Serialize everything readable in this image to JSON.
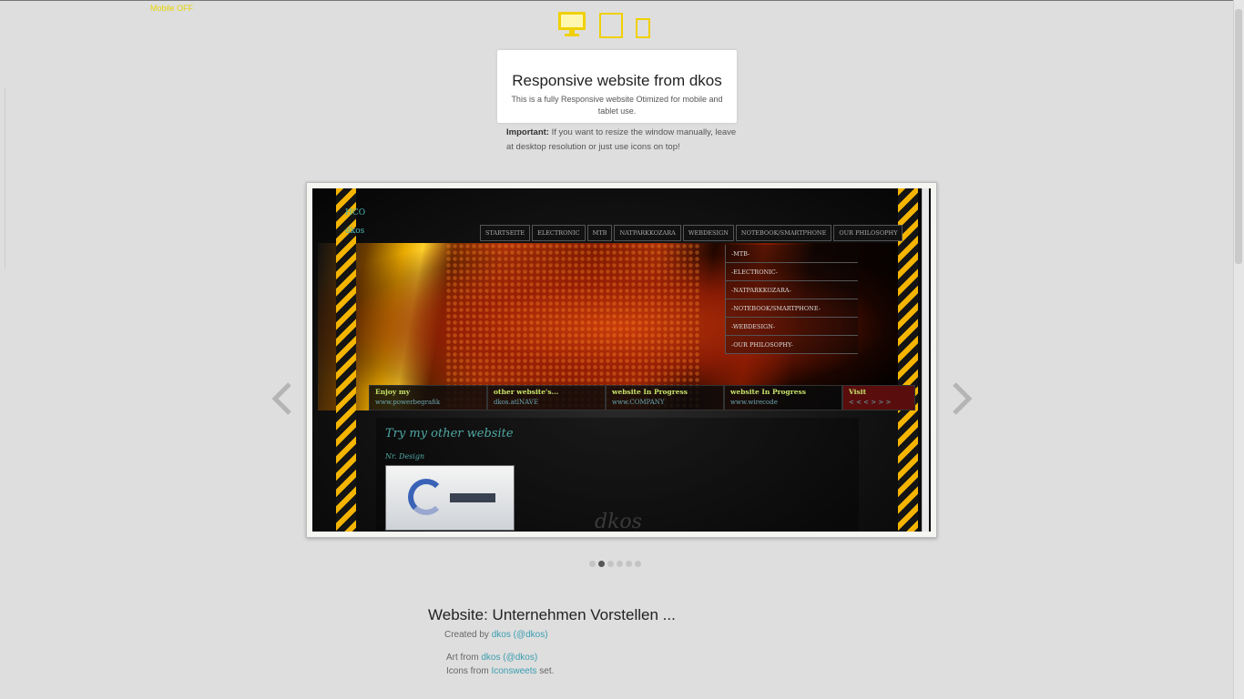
{
  "corner_label": "Mobile OFF",
  "devices": {
    "desktop": "desktop-icon",
    "tablet": "tablet-icon",
    "phone": "phone-icon",
    "accent_color": "#f0d000"
  },
  "intro": {
    "title": "Responsive website from dkos",
    "description": "This is a fully Responsive website Otimized for mobile and tablet use.",
    "important_label": "Important:",
    "important_text": " If you want to resize the window manually, leave at desktop resolution or just use icons on top!"
  },
  "slide": {
    "logo_top": "HCO",
    "logo_sub": "dkos",
    "nav": [
      "STARTSEITE",
      "ELECTRONIC",
      "MTB",
      "NATPARKKOZARA",
      "WEBDESIGN",
      "NOTEBOOK/SMARTPHONE",
      "OUR PHILOSOPHY"
    ],
    "submenu": [
      "-MTB-",
      "-ELECTRONIC-",
      "-NATPARKKOZARA-",
      "-NOTEBOOK/SMARTPHONE-",
      "-WEBDESIGN-",
      "-OUR PHILOSOPHY-"
    ],
    "links": [
      {
        "title": "Enjoy my",
        "url": "www.powerbegrafik"
      },
      {
        "title": "other website's...",
        "url": "dkos.atlNAVE"
      },
      {
        "title": "website In Progress",
        "url": "www.COMPANY"
      },
      {
        "title": "website In Progress",
        "url": "www.wirecode"
      },
      {
        "title": "Visit",
        "url": "< < < > > >"
      }
    ],
    "heading": "Try my other website",
    "subheading": "Nr. Design",
    "signature": "dkos"
  },
  "slider": {
    "prev_icon": "chevron-left-icon",
    "next_icon": "chevron-right-icon",
    "dot_count": 6,
    "active_dot": 1
  },
  "footer": {
    "title": "Website: Unternehmen Vorstellen ...",
    "created_prefix": "Created by ",
    "created_link": "dkos (@dkos)",
    "art_prefix": "Art from ",
    "art_link": "dkos (@dkos)",
    "icons_prefix": "Icons from ",
    "icons_link": "Iconsweets",
    "icons_suffix": " set."
  }
}
